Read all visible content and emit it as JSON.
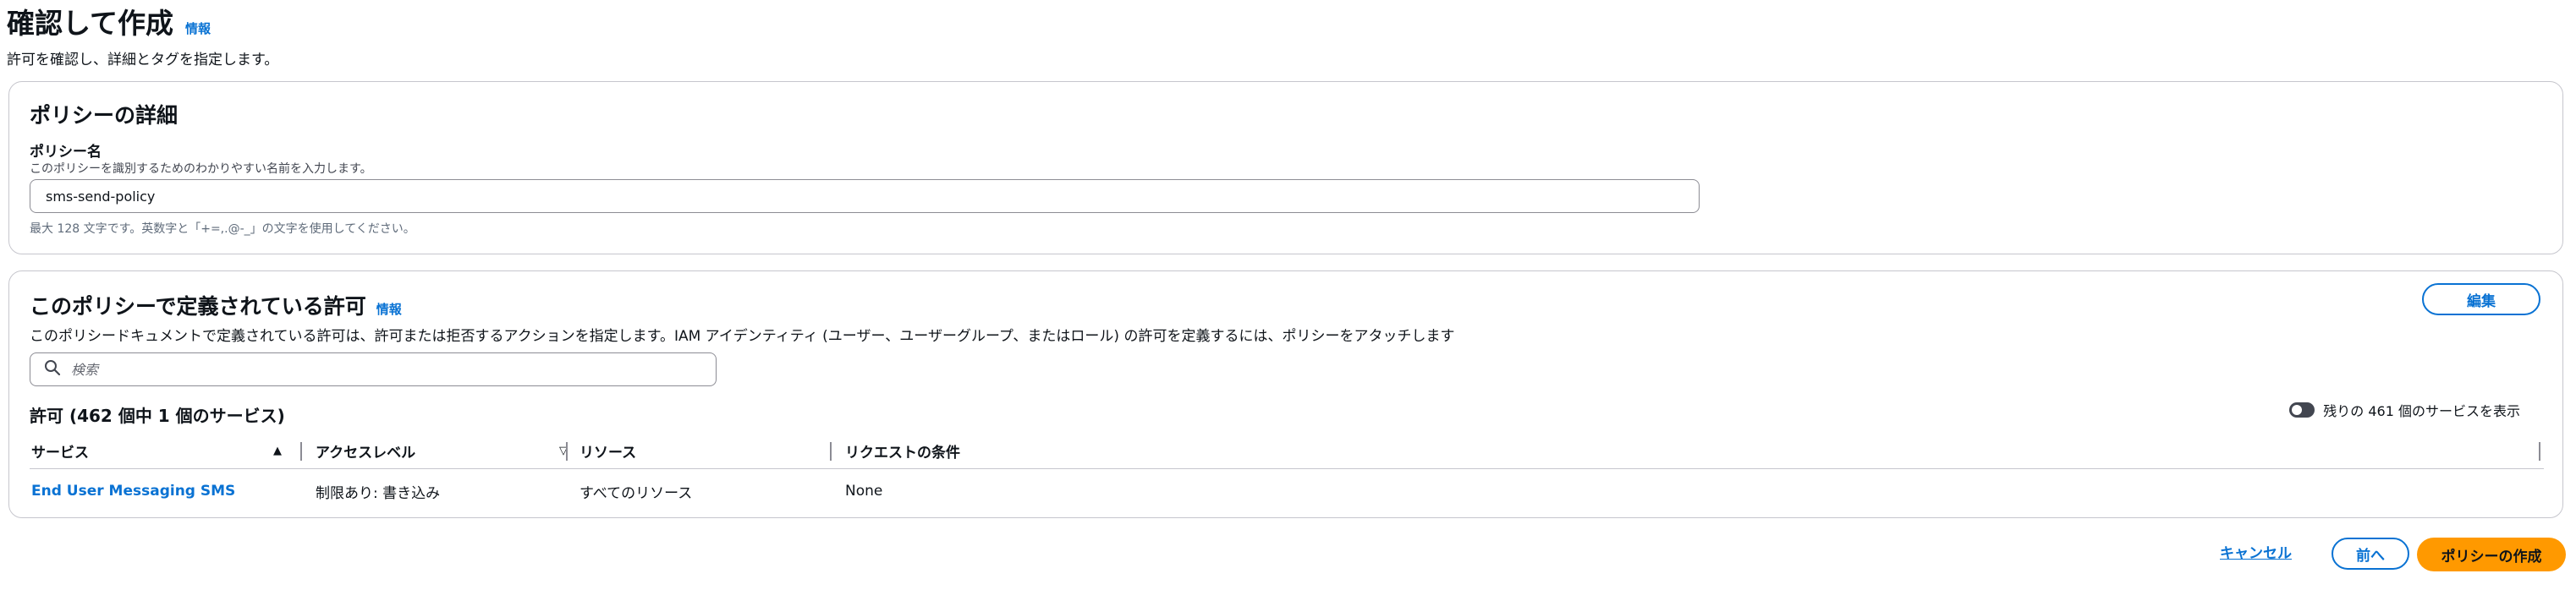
{
  "header": {
    "title": "確認して作成",
    "info": "情報",
    "description": "許可を確認し、詳細とタグを指定します。"
  },
  "details": {
    "title": "ポリシーの詳細",
    "name_label": "ポリシー名",
    "name_desc": "このポリシーを識別するためのわかりやすい名前を入力します。",
    "name_value": "sms-send-policy",
    "name_constraint": "最大 128 文字です。英数字と「+=,.@-_」の文字を使用してください。"
  },
  "permissions": {
    "title": "このポリシーで定義されている許可",
    "info": "情報",
    "description": "このポリシードキュメントで定義されている許可は、許可または拒否するアクションを指定します。IAM アイデンティティ (ユーザー、ユーザーグループ、またはロール) の許可を定義するには、ポリシーをアタッチします",
    "edit_label": "編集",
    "search_placeholder": "検索",
    "count_title": "許可 (462 個中 1 個のサービス)",
    "toggle_label": "残りの 461 個のサービスを表示",
    "columns": {
      "service": "サービス",
      "access_level": "アクセスレベル",
      "resource": "リソース",
      "condition": "リクエストの条件"
    },
    "rows": [
      {
        "service": "End User Messaging SMS",
        "access_level": "制限あり: 書き込み",
        "resource": "すべてのリソース",
        "condition": "None"
      }
    ]
  },
  "footer": {
    "cancel": "キャンセル",
    "prev": "前へ",
    "create": "ポリシーの作成"
  },
  "colors": {
    "link": "#0972d3",
    "primary": "#ff9900",
    "border": "#c6c6cd"
  }
}
